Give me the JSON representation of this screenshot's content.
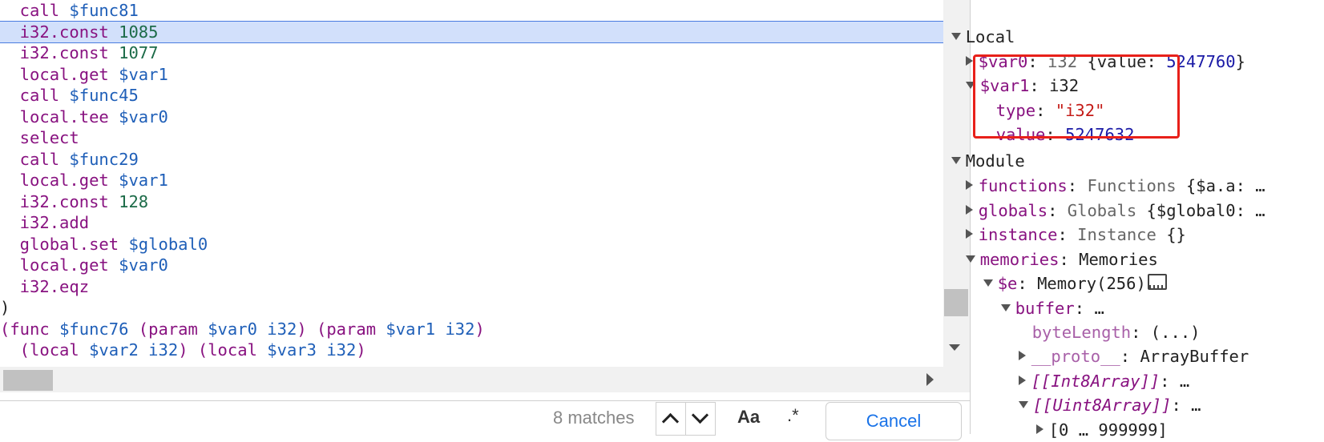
{
  "code": {
    "lines": [
      {
        "parts": [
          {
            "t": "  call ",
            "c": "kw"
          },
          {
            "t": "$func81",
            "c": "var2"
          }
        ]
      },
      {
        "parts": [
          {
            "t": "  i32.const ",
            "c": "kw"
          },
          {
            "t": "1085",
            "c": "num"
          }
        ],
        "highlight": true
      },
      {
        "parts": [
          {
            "t": "  i32.const ",
            "c": "kw"
          },
          {
            "t": "1077",
            "c": "num"
          }
        ]
      },
      {
        "parts": [
          {
            "t": "  local.get ",
            "c": "kw"
          },
          {
            "t": "$var1",
            "c": "var2"
          }
        ]
      },
      {
        "parts": [
          {
            "t": "  call ",
            "c": "kw"
          },
          {
            "t": "$func45",
            "c": "var2"
          }
        ]
      },
      {
        "parts": [
          {
            "t": "  local.tee ",
            "c": "kw"
          },
          {
            "t": "$var0",
            "c": "var2"
          }
        ]
      },
      {
        "parts": [
          {
            "t": "  select",
            "c": "kw"
          }
        ]
      },
      {
        "parts": [
          {
            "t": "  call ",
            "c": "kw"
          },
          {
            "t": "$func29",
            "c": "var2"
          }
        ]
      },
      {
        "parts": [
          {
            "t": "  local.get ",
            "c": "kw"
          },
          {
            "t": "$var1",
            "c": "var2"
          }
        ]
      },
      {
        "parts": [
          {
            "t": "  i32.const ",
            "c": "kw"
          },
          {
            "t": "128",
            "c": "num"
          }
        ]
      },
      {
        "parts": [
          {
            "t": "  i32.add",
            "c": "kw"
          }
        ]
      },
      {
        "parts": [
          {
            "t": "  global.set ",
            "c": "kw"
          },
          {
            "t": "$global0",
            "c": "var2"
          }
        ]
      },
      {
        "parts": [
          {
            "t": "  local.get ",
            "c": "kw"
          },
          {
            "t": "$var0",
            "c": "var2"
          }
        ]
      },
      {
        "parts": [
          {
            "t": "  i32.eqz",
            "c": "kw"
          }
        ]
      },
      {
        "parts": [
          {
            "t": ")",
            "c": "plain"
          }
        ]
      },
      {
        "parts": [
          {
            "t": "(func ",
            "c": "kw"
          },
          {
            "t": "$func76",
            "c": "var2"
          },
          {
            "t": " (param ",
            "c": "kw"
          },
          {
            "t": "$var0",
            "c": "var2"
          },
          {
            "t": " i32",
            "c": "var2"
          },
          {
            "t": ") (param ",
            "c": "kw"
          },
          {
            "t": "$var1",
            "c": "var2"
          },
          {
            "t": " i32",
            "c": "var2"
          },
          {
            "t": ")",
            "c": "kw"
          }
        ]
      },
      {
        "parts": [
          {
            "t": "  (local ",
            "c": "kw"
          },
          {
            "t": "$var2",
            "c": "var2"
          },
          {
            "t": " i32",
            "c": "var2"
          },
          {
            "t": ") (local ",
            "c": "kw"
          },
          {
            "t": "$var3",
            "c": "var2"
          },
          {
            "t": " i32",
            "c": "var2"
          },
          {
            "t": ")",
            "c": "kw"
          }
        ]
      }
    ]
  },
  "search": {
    "match_count": "8 matches",
    "case_label": "Aa",
    "regex_label": ".*",
    "cancel_label": "Cancel"
  },
  "scope": {
    "local_label": "Local",
    "var0_name": "$var0",
    "var0_sep": ": ",
    "var0_type": "i32",
    "var0_preview_open": " {value: ",
    "var0_value": "5247760",
    "var0_preview_close": "}",
    "var1_name": "$var1",
    "var1_sep": ": ",
    "var1_type": "i32",
    "type_key": "type",
    "type_value": "\"i32\"",
    "value_key": "value",
    "value_value": "5247632",
    "module_label": "Module",
    "functions_key": "functions",
    "functions_val": "Functions",
    "functions_preview": " {$a.a: …",
    "globals_key": "globals",
    "globals_val": "Globals",
    "globals_preview": " {$global0: …",
    "instance_key": "instance",
    "instance_val": "Instance",
    "instance_preview": " {}",
    "memories_key": "memories",
    "memories_val": "Memories",
    "e_key": "$e",
    "e_val": "Memory(256)",
    "buffer_key": "buffer",
    "buffer_val": "…",
    "bytelength_key": "byteLength",
    "bytelength_val": "(...)",
    "proto_key": "__proto__",
    "proto_val": "ArrayBuffer",
    "int8_key": "[[Int8Array]]",
    "int8_val": "…",
    "uint8_key": "[[Uint8Array]]",
    "uint8_val": "…",
    "range_label": "[0 … 999999]"
  }
}
